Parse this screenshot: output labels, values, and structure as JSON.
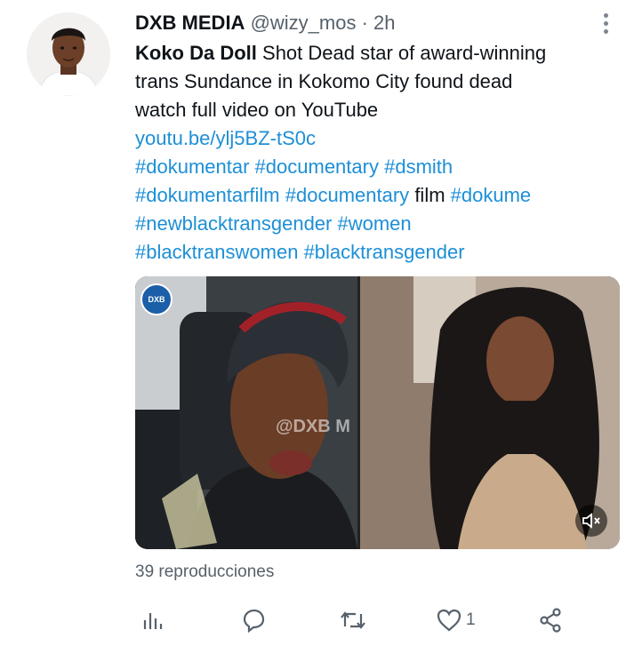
{
  "tweet": {
    "author_name": "DXB MEDIA",
    "handle": "@wizy_mos",
    "separator": " · ",
    "time": "2h",
    "lead_bold": "Koko Da Doll",
    "text_line1": " Shot Dead star of award-winning",
    "text_line2": "trans Sundance in Kokomo City found dead",
    "text_line3": "watch full video on YouTube",
    "link": "youtu.be/ylj5BZ-tS0c",
    "hashtags_line1": [
      "#dokumentar",
      "#documentary",
      "#dsmith"
    ],
    "hashtags_line2_a": "#dokumentarfilm",
    "hashtags_line2_b": "#documentary",
    "line2_plain": "film",
    "hashtags_line2_c": "#dokume",
    "hashtags_line3": [
      "#newblacktransgender",
      "#women"
    ],
    "hashtags_line4": [
      "#blacktranswomen",
      "#blacktransgender"
    ]
  },
  "media": {
    "watermark": "@DXB MEDIA",
    "watermark_visible": "@DXB M",
    "badge_text": "DXB"
  },
  "views_text": "39 reproducciones",
  "actions": {
    "like_count": "1"
  },
  "icons": {
    "menu": "more-vertical-icon",
    "analytics": "analytics-icon",
    "reply": "reply-icon",
    "retweet": "retweet-icon",
    "like": "heart-icon",
    "share": "share-icon",
    "mute": "mute-icon"
  }
}
